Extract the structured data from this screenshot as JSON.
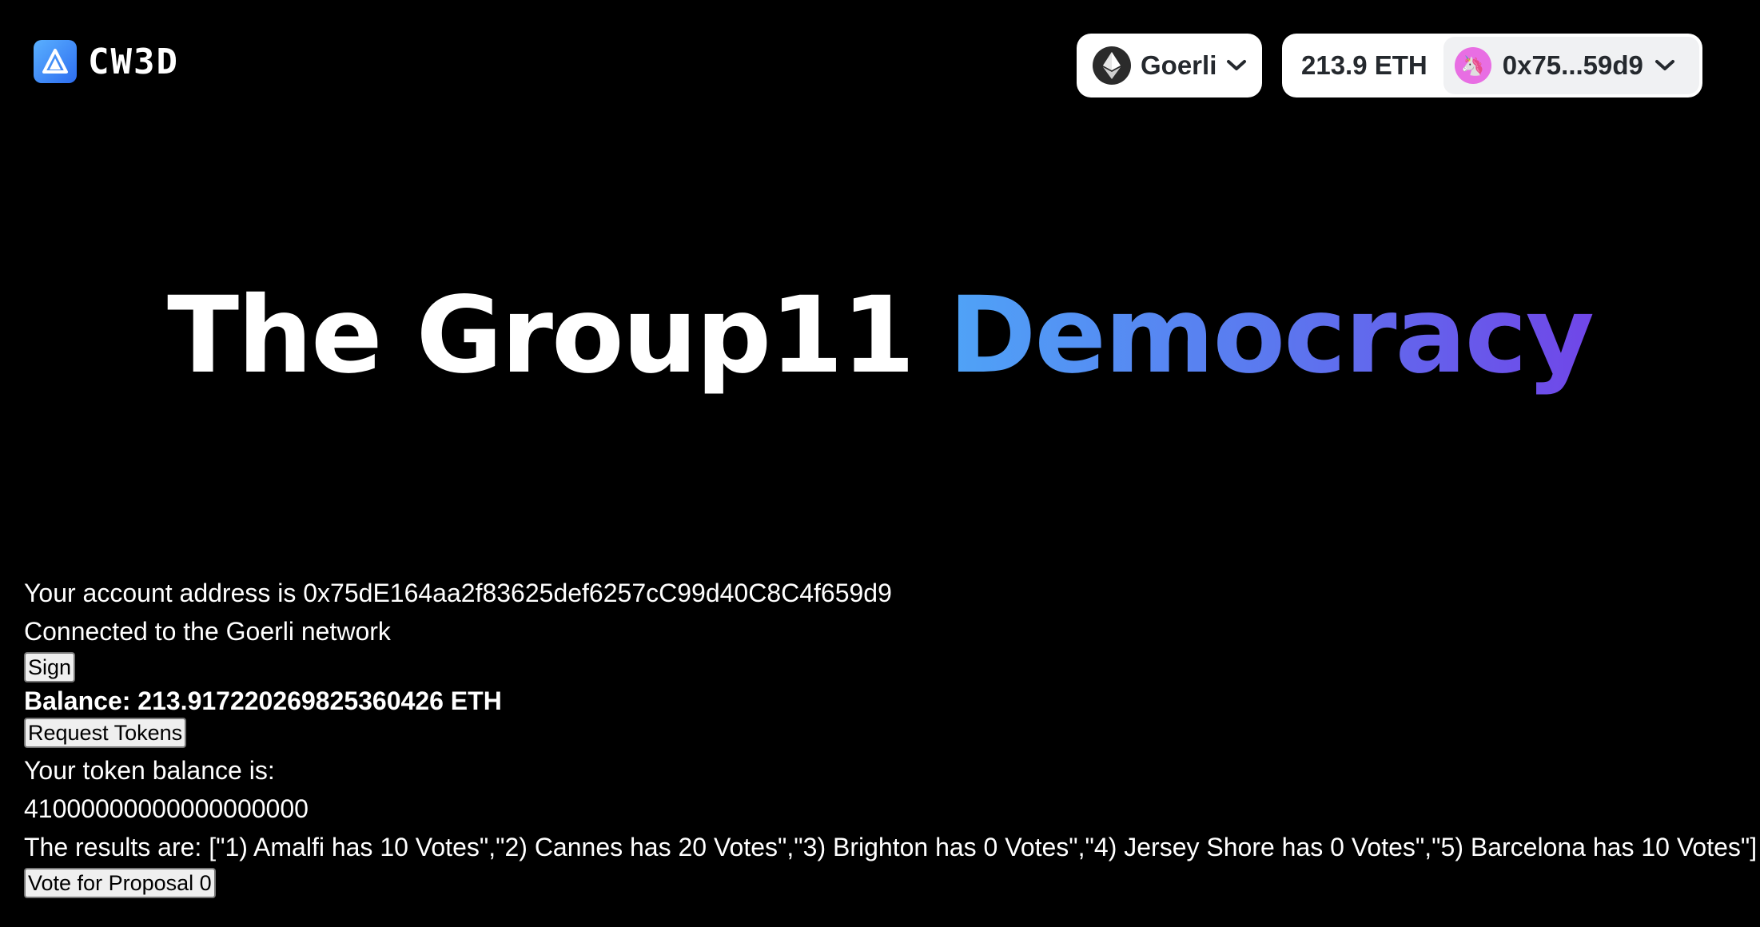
{
  "header": {
    "logo_text": "CW3D",
    "chain_button": {
      "label": "Goerli",
      "icon": "ethereum-icon"
    },
    "account_button": {
      "balance": "213.9 ETH",
      "address": "0x75...59d9",
      "avatar_icon": "unicorn-icon",
      "avatar_color": "#e86ee3"
    }
  },
  "hero": {
    "title_white": "The Group11",
    "title_gradient": "Democracy",
    "gradient_colors": [
      "#4fa3f7",
      "#7046e8"
    ]
  },
  "content": {
    "account_address": "Your account address is 0x75dE164aa2f83625def6257cC99d40C8C4f659d9",
    "network": "Connected to the Goerli network",
    "sign_button": "Sign",
    "balance": "Balance: 213.917220269825360426 ETH",
    "request_tokens_button": "Request Tokens",
    "token_balance_label": "Your token balance is:",
    "token_balance_value": "41000000000000000000",
    "results": "The results are: [\"1) Amalfi has 10 Votes\",\"2) Cannes has 20 Votes\",\"3) Brighton has 0 Votes\",\"4) Jersey Shore has 0 Votes\",\"5) Barcelona has 10 Votes\"]",
    "vote_button": "Vote for Proposal 0"
  }
}
